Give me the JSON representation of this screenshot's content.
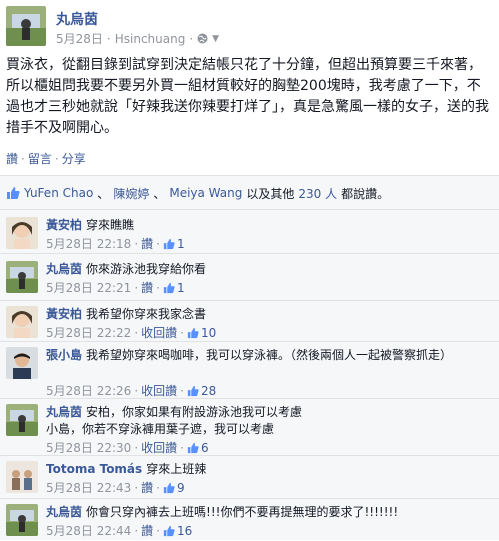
{
  "post": {
    "author": "丸烏茵",
    "date": "5月28日",
    "location": "Hsinchuang",
    "body": "買泳衣，從翻目錄到試穿到決定結帳只花了十分鐘，但超出預算要三千來著，所以櫃姐問我要不要另外買一組材質較好的胸墊200塊時，我考慮了一下，不過也才三秒她就說「好辣我送你辣要打烊了」，真是急驚風一樣的女子，送的我措手不及啊開心。",
    "actions": [
      "讚",
      "留言",
      "分享"
    ]
  },
  "likes": {
    "text_pre": "YuFen Chao",
    "name2": "陳婉婷",
    "name3": "Meiya Wang",
    "others_prefix": "以及其他",
    "others_count": "230 人",
    "suffix": "都說讚。"
  },
  "comments": [
    {
      "name": "黃安柏",
      "text": "穿來瞧瞧",
      "date": "5月28日 22:18",
      "like_label": "讚",
      "likes": "1"
    },
    {
      "name": "丸烏茵",
      "text": "你來游泳池我穿給你看",
      "date": "5月28日 22:21",
      "like_label": "讚",
      "likes": "1"
    },
    {
      "name": "黃安柏",
      "text": "我希望你穿來我家念書",
      "date": "5月28日 22:22",
      "like_label": "讚",
      "retract": "收回讚",
      "likes": "10"
    },
    {
      "name": "張小島",
      "text": "我希望妳穿來喝咖啡，我可以穿泳褲。（然後兩個人一起被警察抓走）",
      "date": "5月28日 22:26",
      "like_label": "讚",
      "retract": "收回讚",
      "likes": "28"
    },
    {
      "name": "丸烏茵",
      "text": "安柏，你家如果有附設游泳池我可以考慮",
      "text2": "小島，你若不穿泳褲用葉子遮，我可以考慮",
      "date": "5月28日 22:30",
      "like_label": "讚",
      "retract": "收回讚",
      "likes": "6"
    },
    {
      "name": "Totoma Tomás",
      "text": "穿來上班辣",
      "date": "5月28日 22:43",
      "like_label": "讚",
      "likes": "9"
    },
    {
      "name": "丸烏茵",
      "text": "你會只穿內褲去上班嗎!!!你們不要再提無理的要求了!!!!!!!",
      "date": "5月28日 22:44",
      "like_label": "讚",
      "likes": "16"
    }
  ]
}
